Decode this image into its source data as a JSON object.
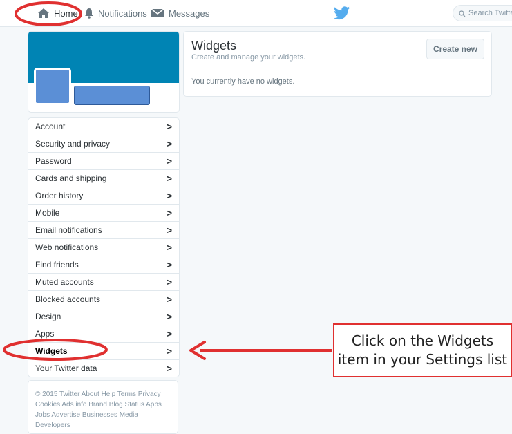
{
  "nav": {
    "home": "Home",
    "notifications": "Notifications",
    "messages": "Messages",
    "search_placeholder": "Search Twitter"
  },
  "widgets": {
    "title": "Widgets",
    "subtitle": "Create and manage your widgets.",
    "create_button": "Create new",
    "empty_text": "You currently have no widgets."
  },
  "settings": {
    "items": [
      {
        "label": "Account"
      },
      {
        "label": "Security and privacy"
      },
      {
        "label": "Password"
      },
      {
        "label": "Cards and shipping"
      },
      {
        "label": "Order history"
      },
      {
        "label": "Mobile"
      },
      {
        "label": "Email notifications"
      },
      {
        "label": "Web notifications"
      },
      {
        "label": "Find friends"
      },
      {
        "label": "Muted accounts"
      },
      {
        "label": "Blocked accounts"
      },
      {
        "label": "Design"
      },
      {
        "label": "Apps"
      },
      {
        "label": "Widgets",
        "active": true
      },
      {
        "label": "Your Twitter data"
      }
    ],
    "chevron": ">"
  },
  "footer": {
    "text": "© 2015 Twitter  About  Help  Terms  Privacy  Cookies  Ads info  Brand  Blog  Status  Apps  Jobs  Advertise  Businesses  Media  Developers"
  },
  "annotation": {
    "callout_line1": "Click on the Widgets",
    "callout_line2": "item in your Settings list"
  },
  "colors": {
    "banner": "#0084b4",
    "placeholder_blue": "#5b8fd6",
    "twitter_blue": "#55acee",
    "annotation_red": "#e03030"
  },
  "icons": {
    "home": "home-icon",
    "notifications": "bell-icon",
    "messages": "envelope-icon",
    "logo": "twitter-bird-icon",
    "search": "search-icon"
  }
}
